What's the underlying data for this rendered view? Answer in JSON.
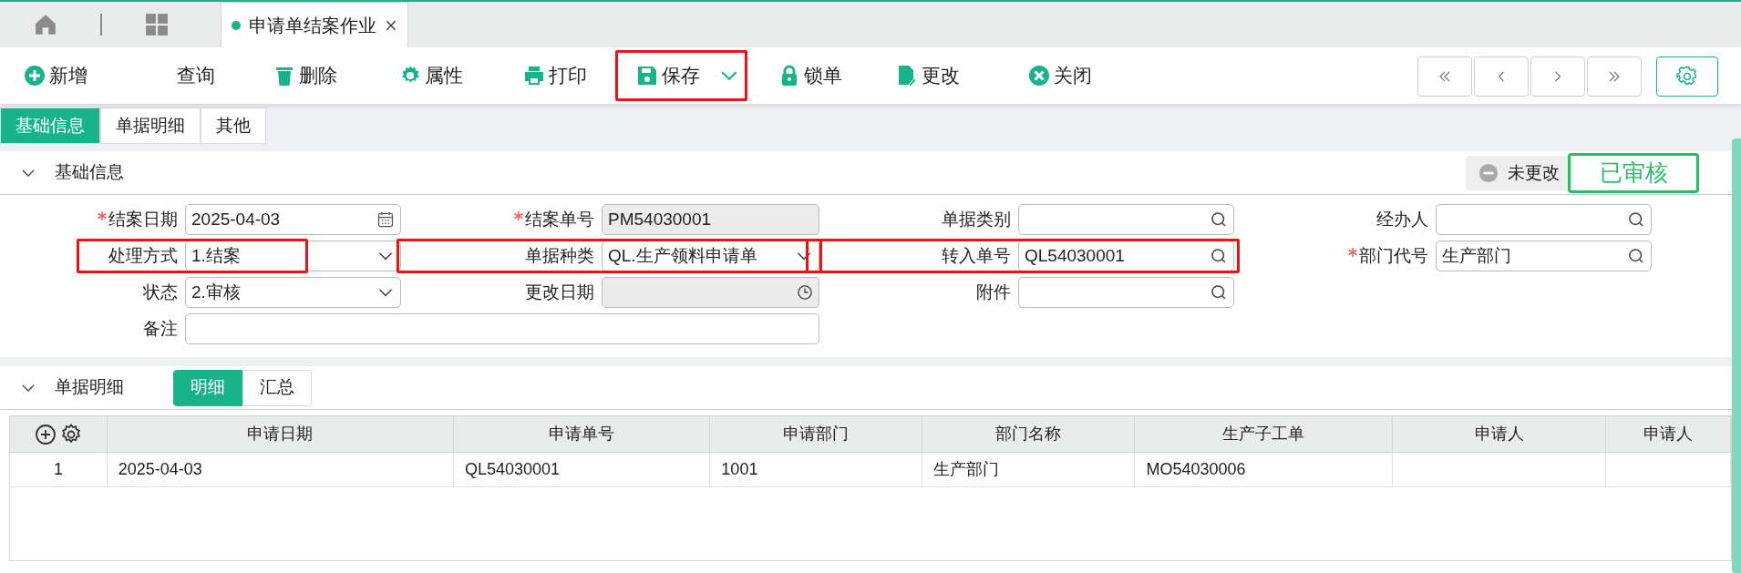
{
  "top_tabs": [
    {
      "kind": "home",
      "selected": false
    },
    {
      "kind": "apps",
      "selected": false
    },
    {
      "kind": "document",
      "label": "申请单结案作业",
      "selected": true
    }
  ],
  "toolbar": [
    {
      "kind": "add",
      "label": "新增"
    },
    {
      "kind": "query",
      "label": "查询"
    },
    {
      "kind": "delete",
      "label": "删除"
    },
    {
      "kind": "properties",
      "label": "属性"
    },
    {
      "kind": "print",
      "label": "打印"
    },
    {
      "kind": "save",
      "label": "保存",
      "dropdown": true,
      "highlighted": true
    },
    {
      "kind": "lock",
      "label": "锁单"
    },
    {
      "kind": "edit",
      "label": "更改"
    },
    {
      "kind": "close",
      "label": "关闭"
    }
  ],
  "section_tabs": [
    {
      "label": "基础信息",
      "selected": true
    },
    {
      "label": "单据明细",
      "selected": false
    },
    {
      "label": "其他",
      "selected": false
    }
  ],
  "basic_info": {
    "title": "基础信息",
    "expanded": true,
    "change_status": "未更改",
    "approval_badge": "已审核",
    "rows": [
      [
        {
          "label": "结案日期",
          "value": "2025-04-03",
          "kind": "date",
          "required": true,
          "disabled": false,
          "highlighted": false
        },
        {
          "label": "结案单号",
          "value": "PM54030001",
          "kind": "text",
          "required": true,
          "disabled": true,
          "highlighted": false
        },
        {
          "label": "单据类别",
          "kind": "lookup",
          "required": false,
          "disabled": false,
          "highlighted": false
        },
        {
          "label": "经办人",
          "kind": "lookup",
          "required": false,
          "disabled": false,
          "highlighted": false
        }
      ],
      [
        {
          "label": "处理方式",
          "value": "1.结案",
          "kind": "select",
          "required": false,
          "disabled": false,
          "highlighted": true
        },
        {
          "label": "单据种类",
          "value": "QL.生产领料申请单",
          "kind": "select",
          "required": false,
          "disabled": false,
          "highlighted": true
        },
        {
          "label": "转入单号",
          "value": "QL54030001",
          "kind": "lookup",
          "required": false,
          "disabled": false,
          "highlighted": true
        },
        {
          "label": "部门代号",
          "value": "生产部门",
          "kind": "lookup",
          "required": true,
          "disabled": false,
          "highlighted": false
        }
      ],
      [
        {
          "label": "状态",
          "value": "2.审核",
          "kind": "select",
          "required": false,
          "disabled": false,
          "highlighted": false
        },
        {
          "label": "更改日期",
          "kind": "time",
          "required": false,
          "disabled": true,
          "highlighted": false
        },
        {
          "label": "附件",
          "kind": "lookup",
          "required": false,
          "disabled": false,
          "highlighted": false
        }
      ],
      [
        {
          "label": "备注",
          "kind": "wide",
          "required": false,
          "disabled": false,
          "highlighted": false
        }
      ]
    ]
  },
  "detail": {
    "title": "单据明细",
    "expanded": true,
    "tabs": [
      {
        "label": "明细",
        "selected": true
      },
      {
        "label": "汇总",
        "selected": false
      }
    ],
    "columns": [
      "申请日期",
      "申请单号",
      "申请部门",
      "部门名称",
      "生产子工单",
      "申请人",
      "申请人"
    ],
    "rows": [
      [
        "1",
        "2025-04-03",
        "QL54030001",
        "1001",
        "生产部门",
        "MO54030006",
        "",
        ""
      ]
    ]
  }
}
